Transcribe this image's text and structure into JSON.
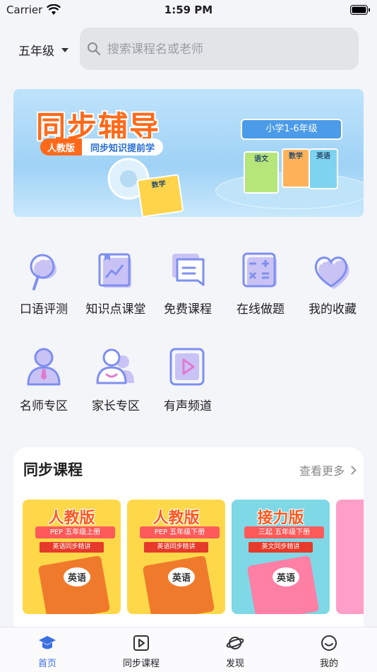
{
  "status_bar": {
    "carrier": "Carrier",
    "time": "1:59 PM"
  },
  "header": {
    "grade": "五年级",
    "search_placeholder": "搜索课程名或老师"
  },
  "banner": {
    "title": "同步辅导",
    "edition": "人教版",
    "slogan": "同步知识提前学",
    "badge": "小学1-6年级",
    "book_labels": [
      "语文",
      "数学",
      "英语",
      "数学"
    ]
  },
  "features": [
    {
      "label": "口语评测",
      "icon": "microphone-icon"
    },
    {
      "label": "知识点课堂",
      "icon": "chart-book-icon"
    },
    {
      "label": "免费课程",
      "icon": "chat-stack-icon"
    },
    {
      "label": "在线做题",
      "icon": "calculator-icon"
    },
    {
      "label": "我的收藏",
      "icon": "heart-icon"
    },
    {
      "label": "名师专区",
      "icon": "teacher-icon"
    },
    {
      "label": "家长专区",
      "icon": "parents-icon"
    },
    {
      "label": "有声频道",
      "icon": "play-icon"
    }
  ],
  "sync_courses": {
    "title": "同步课程",
    "more": "查看更多",
    "cards": [
      {
        "edition": "人教版",
        "badge": "PEP",
        "grade": "五年级上册",
        "tag": "英语同步精讲",
        "book": "英语",
        "bg": "#ffd84a"
      },
      {
        "edition": "人教版",
        "badge": "PEP",
        "grade": "五年级下册",
        "tag": "英语同步精讲",
        "book": "英语",
        "bg": "#ffd84a"
      },
      {
        "edition": "接力版",
        "badge": "三起",
        "grade": "五年级下册",
        "tag": "英文同步精讲",
        "book": "英语",
        "bg": "#7fd8e6"
      }
    ]
  },
  "tab_bar": {
    "tabs": [
      {
        "label": "首页",
        "icon": "graduation-cap-icon",
        "active": true
      },
      {
        "label": "同步课程",
        "icon": "video-play-icon",
        "active": false
      },
      {
        "label": "发现",
        "icon": "planet-icon",
        "active": false
      },
      {
        "label": "我的",
        "icon": "smile-face-icon",
        "active": false
      }
    ]
  },
  "colors": {
    "accent": "#3b6fe0",
    "icon_primary": "#7e8ff0",
    "icon_secondary": "#c9c3f5"
  }
}
